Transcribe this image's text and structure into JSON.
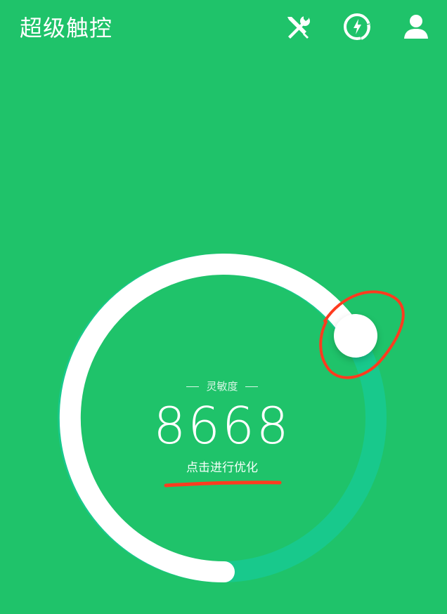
{
  "header": {
    "title": "超级触控",
    "icons": [
      "tools-icon",
      "boost-icon",
      "user-icon"
    ]
  },
  "gauge": {
    "label": "灵敏度",
    "value": "8668",
    "action": "点击进行优化",
    "colors": {
      "track_filled": "#ffffff",
      "track_remaining": "#18c98c",
      "background": "#1fc36a",
      "annotation": "#ff3b1f"
    }
  }
}
